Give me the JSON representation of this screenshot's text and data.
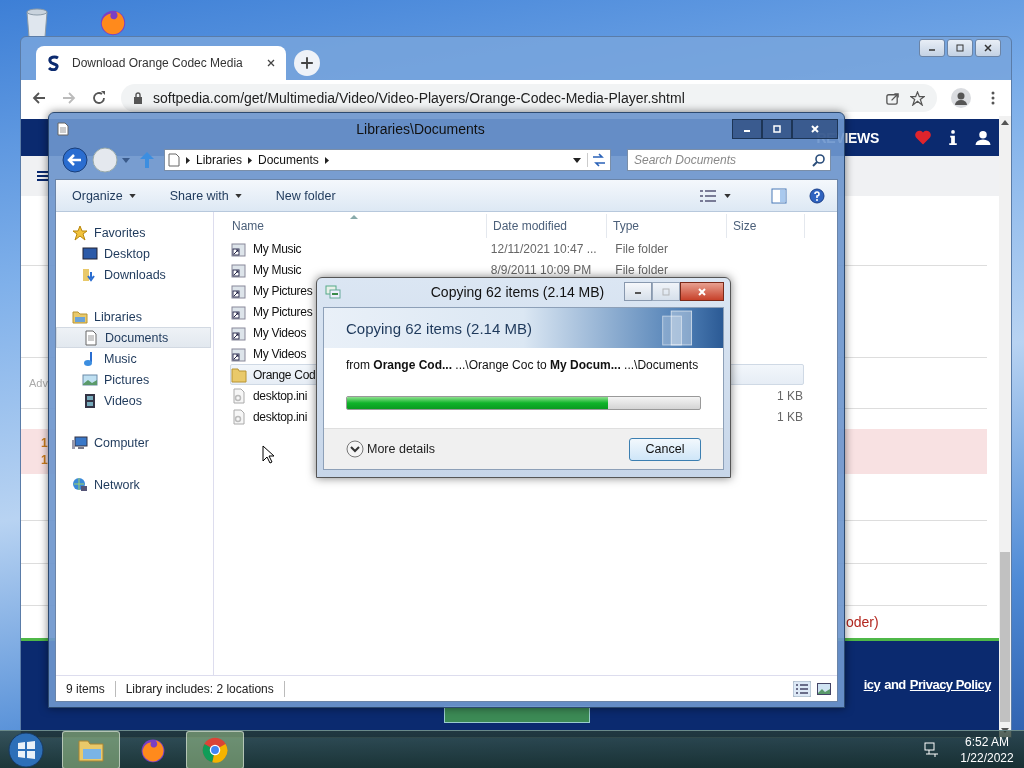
{
  "browser": {
    "tabs": [
      {
        "title": "Download Orange Codec Media",
        "selected": true
      }
    ],
    "url": "softpedia.com/get/Multimedia/Video/Video-Players/Orange-Codec-Media-Player.shtml"
  },
  "page": {
    "nav_label": "REVIEWS",
    "side_text": "Adv",
    "badges": [
      "1",
      "1"
    ],
    "error_text": "oder)",
    "footer": [
      {
        "text": "icy",
        "link": true
      },
      {
        "text": "and",
        "link": false
      },
      {
        "text": "Privacy Policy",
        "link": true
      }
    ]
  },
  "explorer": {
    "title": "Libraries\\Documents",
    "breadcrumb": [
      "Libraries",
      "Documents"
    ],
    "search": {
      "placeholder": "Search Documents"
    },
    "toolbar": [
      {
        "label": "Organize",
        "dropdown": true
      },
      {
        "label": "Share with",
        "dropdown": true
      },
      {
        "label": "New folder",
        "dropdown": false
      }
    ],
    "sidebar": [
      {
        "label": "Favorites",
        "kind": "star",
        "selected": false,
        "children": [
          {
            "label": "Desktop",
            "kind": "desktop",
            "selected": false
          },
          {
            "label": "Downloads",
            "kind": "downloads",
            "selected": false
          }
        ]
      },
      {
        "label": "Libraries",
        "kind": "library",
        "selected": false,
        "children": [
          {
            "label": "Documents",
            "kind": "documents",
            "selected": true
          },
          {
            "label": "Music",
            "kind": "music",
            "selected": false
          },
          {
            "label": "Pictures",
            "kind": "pictures",
            "selected": false
          },
          {
            "label": "Videos",
            "kind": "videos",
            "selected": false
          }
        ]
      },
      {
        "label": "Computer",
        "kind": "computer",
        "selected": false
      },
      {
        "label": "Network",
        "kind": "network",
        "selected": false
      }
    ],
    "columns": [
      {
        "label": "Name",
        "sorted": true
      },
      {
        "label": "Date modified",
        "sorted": false
      },
      {
        "label": "Type",
        "sorted": false
      },
      {
        "label": "Size",
        "sorted": false
      }
    ],
    "rows": [
      {
        "name": "My Music",
        "kind": "shortcut",
        "date": "12/11/2021 10:47 ...",
        "type": "File folder",
        "selected": false
      },
      {
        "name": "My Music",
        "kind": "shortcut",
        "date": "8/9/2011 10:09 PM",
        "type": "File folder",
        "selected": false
      },
      {
        "name": "My Pictures",
        "kind": "shortcut",
        "selected": false
      },
      {
        "name": "My Pictures",
        "kind": "shortcut",
        "selected": false
      },
      {
        "name": "My Videos",
        "kind": "shortcut",
        "selected": false
      },
      {
        "name": "My Videos",
        "kind": "shortcut",
        "selected": false
      },
      {
        "name": "Orange Cod",
        "kind": "folder",
        "selected": true
      },
      {
        "name": "desktop.ini",
        "kind": "file",
        "size": "1 KB",
        "selected": false
      },
      {
        "name": "desktop.ini",
        "kind": "file",
        "size": "1 KB",
        "selected": false
      }
    ],
    "status": [
      "9 items",
      "Library includes: 2 locations"
    ]
  },
  "dialog": {
    "title": "Copying 62 items (2.14 MB)",
    "heading": "Copying 62 items (2.14 MB)",
    "detail": "from **Orange Cod...** ...\\Orange Coc to **My Docum...** ...\\Documents",
    "level": 0.74,
    "details_label": "More details",
    "expanded": false,
    "button": "Cancel"
  },
  "taskbar": {
    "apps": [
      {
        "kind": "explorer",
        "selected": true
      },
      {
        "kind": "firefox",
        "selected": false
      },
      {
        "kind": "chrome",
        "selected": true
      }
    ],
    "time": "6:52 AM",
    "date": "1/22/2022"
  }
}
